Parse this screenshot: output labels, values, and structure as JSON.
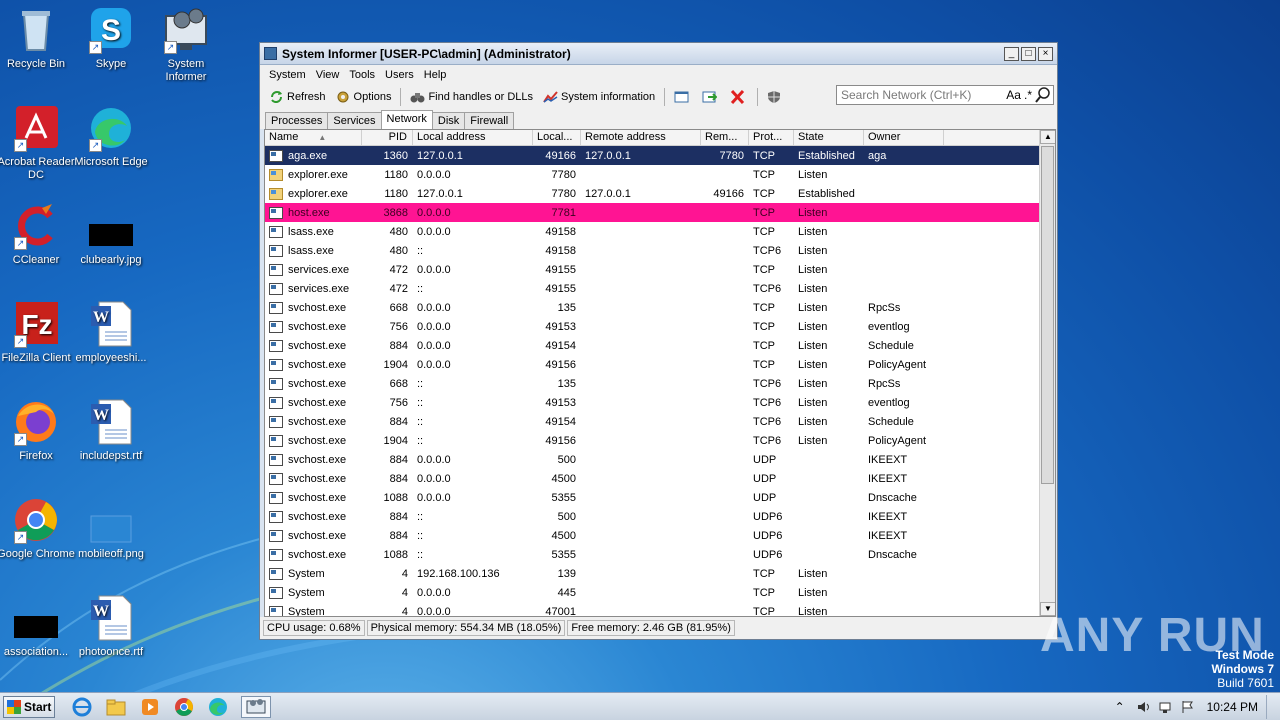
{
  "desktop": {
    "icons": [
      {
        "label": "Recycle Bin"
      },
      {
        "label": "Skype"
      },
      {
        "label": "System Informer"
      },
      {
        "label": "Acrobat Reader DC"
      },
      {
        "label": "Microsoft Edge"
      },
      {
        "label": "CCleaner"
      },
      {
        "label": "clubearly.jpg"
      },
      {
        "label": "FileZilla Client"
      },
      {
        "label": "employeeshi..."
      },
      {
        "label": "Firefox"
      },
      {
        "label": "includepst.rtf"
      },
      {
        "label": "Google Chrome"
      },
      {
        "label": "mobileoff.png"
      },
      {
        "label": "association..."
      },
      {
        "label": "photoonce.rtf"
      }
    ]
  },
  "window": {
    "title": "System Informer [USER-PC\\admin] (Administrator)",
    "controls": {
      "minimize": "_",
      "maximize": "□",
      "close": "×"
    },
    "menu": [
      "System",
      "View",
      "Tools",
      "Users",
      "Help"
    ],
    "toolbar": {
      "refresh": "Refresh",
      "options": "Options",
      "find_handles": "Find handles or DLLs",
      "system_information": "System information"
    },
    "search": {
      "placeholder": "Search Network (Ctrl+K)",
      "case_toggle": "Aa",
      "regex_toggle": ".*"
    },
    "tabs": [
      "Processes",
      "Services",
      "Network",
      "Disk",
      "Firewall"
    ],
    "active_tab": "Network",
    "columns": [
      "Name",
      "PID",
      "Local address",
      "Local...",
      "Remote address",
      "Rem...",
      "Prot...",
      "State",
      "Owner"
    ],
    "rows": [
      {
        "name": "aga.exe",
        "pid": "1360",
        "laddr": "127.0.0.1",
        "lport": "49166",
        "raddr": "127.0.0.1",
        "rport": "7780",
        "proto": "TCP",
        "state": "Established",
        "owner": "aga",
        "icon": "app"
      },
      {
        "name": "explorer.exe",
        "pid": "1180",
        "laddr": "0.0.0.0",
        "lport": "7780",
        "raddr": "",
        "rport": "",
        "proto": "TCP",
        "state": "Listen",
        "owner": "",
        "icon": "folder"
      },
      {
        "name": "explorer.exe",
        "pid": "1180",
        "laddr": "127.0.0.1",
        "lport": "7780",
        "raddr": "127.0.0.1",
        "rport": "49166",
        "proto": "TCP",
        "state": "Established",
        "owner": "",
        "icon": "folder"
      },
      {
        "name": "host.exe",
        "pid": "3868",
        "laddr": "0.0.0.0",
        "lport": "7781",
        "raddr": "",
        "rport": "",
        "proto": "TCP",
        "state": "Listen",
        "owner": "",
        "icon": "app"
      },
      {
        "name": "lsass.exe",
        "pid": "480",
        "laddr": "0.0.0.0",
        "lport": "49158",
        "raddr": "",
        "rport": "",
        "proto": "TCP",
        "state": "Listen",
        "owner": "",
        "icon": "app"
      },
      {
        "name": "lsass.exe",
        "pid": "480",
        "laddr": "::",
        "lport": "49158",
        "raddr": "",
        "rport": "",
        "proto": "TCP6",
        "state": "Listen",
        "owner": "",
        "icon": "app"
      },
      {
        "name": "services.exe",
        "pid": "472",
        "laddr": "0.0.0.0",
        "lport": "49155",
        "raddr": "",
        "rport": "",
        "proto": "TCP",
        "state": "Listen",
        "owner": "",
        "icon": "app"
      },
      {
        "name": "services.exe",
        "pid": "472",
        "laddr": "::",
        "lport": "49155",
        "raddr": "",
        "rport": "",
        "proto": "TCP6",
        "state": "Listen",
        "owner": "",
        "icon": "app"
      },
      {
        "name": "svchost.exe",
        "pid": "668",
        "laddr": "0.0.0.0",
        "lport": "135",
        "raddr": "",
        "rport": "",
        "proto": "TCP",
        "state": "Listen",
        "owner": "RpcSs",
        "icon": "app"
      },
      {
        "name": "svchost.exe",
        "pid": "756",
        "laddr": "0.0.0.0",
        "lport": "49153",
        "raddr": "",
        "rport": "",
        "proto": "TCP",
        "state": "Listen",
        "owner": "eventlog",
        "icon": "app"
      },
      {
        "name": "svchost.exe",
        "pid": "884",
        "laddr": "0.0.0.0",
        "lport": "49154",
        "raddr": "",
        "rport": "",
        "proto": "TCP",
        "state": "Listen",
        "owner": "Schedule",
        "icon": "app"
      },
      {
        "name": "svchost.exe",
        "pid": "1904",
        "laddr": "0.0.0.0",
        "lport": "49156",
        "raddr": "",
        "rport": "",
        "proto": "TCP",
        "state": "Listen",
        "owner": "PolicyAgent",
        "icon": "app"
      },
      {
        "name": "svchost.exe",
        "pid": "668",
        "laddr": "::",
        "lport": "135",
        "raddr": "",
        "rport": "",
        "proto": "TCP6",
        "state": "Listen",
        "owner": "RpcSs",
        "icon": "app"
      },
      {
        "name": "svchost.exe",
        "pid": "756",
        "laddr": "::",
        "lport": "49153",
        "raddr": "",
        "rport": "",
        "proto": "TCP6",
        "state": "Listen",
        "owner": "eventlog",
        "icon": "app"
      },
      {
        "name": "svchost.exe",
        "pid": "884",
        "laddr": "::",
        "lport": "49154",
        "raddr": "",
        "rport": "",
        "proto": "TCP6",
        "state": "Listen",
        "owner": "Schedule",
        "icon": "app"
      },
      {
        "name": "svchost.exe",
        "pid": "1904",
        "laddr": "::",
        "lport": "49156",
        "raddr": "",
        "rport": "",
        "proto": "TCP6",
        "state": "Listen",
        "owner": "PolicyAgent",
        "icon": "app"
      },
      {
        "name": "svchost.exe",
        "pid": "884",
        "laddr": "0.0.0.0",
        "lport": "500",
        "raddr": "",
        "rport": "",
        "proto": "UDP",
        "state": "",
        "owner": "IKEEXT",
        "icon": "app"
      },
      {
        "name": "svchost.exe",
        "pid": "884",
        "laddr": "0.0.0.0",
        "lport": "4500",
        "raddr": "",
        "rport": "",
        "proto": "UDP",
        "state": "",
        "owner": "IKEEXT",
        "icon": "app"
      },
      {
        "name": "svchost.exe",
        "pid": "1088",
        "laddr": "0.0.0.0",
        "lport": "5355",
        "raddr": "",
        "rport": "",
        "proto": "UDP",
        "state": "",
        "owner": "Dnscache",
        "icon": "app"
      },
      {
        "name": "svchost.exe",
        "pid": "884",
        "laddr": "::",
        "lport": "500",
        "raddr": "",
        "rport": "",
        "proto": "UDP6",
        "state": "",
        "owner": "IKEEXT",
        "icon": "app"
      },
      {
        "name": "svchost.exe",
        "pid": "884",
        "laddr": "::",
        "lport": "4500",
        "raddr": "",
        "rport": "",
        "proto": "UDP6",
        "state": "",
        "owner": "IKEEXT",
        "icon": "app"
      },
      {
        "name": "svchost.exe",
        "pid": "1088",
        "laddr": "::",
        "lport": "5355",
        "raddr": "",
        "rport": "",
        "proto": "UDP6",
        "state": "",
        "owner": "Dnscache",
        "icon": "app"
      },
      {
        "name": "System",
        "pid": "4",
        "laddr": "192.168.100.136",
        "lport": "139",
        "raddr": "",
        "rport": "",
        "proto": "TCP",
        "state": "Listen",
        "owner": "",
        "icon": "app"
      },
      {
        "name": "System",
        "pid": "4",
        "laddr": "0.0.0.0",
        "lport": "445",
        "raddr": "",
        "rport": "",
        "proto": "TCP",
        "state": "Listen",
        "owner": "",
        "icon": "app"
      },
      {
        "name": "System",
        "pid": "4",
        "laddr": "0.0.0.0",
        "lport": "47001",
        "raddr": "",
        "rport": "",
        "proto": "TCP",
        "state": "Listen",
        "owner": "",
        "icon": "app"
      }
    ],
    "row_highlights": {
      "selected": "#1c2f62",
      "pink": "#ff1493"
    },
    "status": {
      "cpu": "CPU usage: 0.68%",
      "physical": "Physical memory: 554.34 MB (18.05%)",
      "free": "Free memory: 2.46 GB (81.95%)"
    }
  },
  "watermark": {
    "brand": "ANY RUN",
    "test_mode": "Test Mode",
    "os": "Windows 7",
    "build": "Build 7601"
  },
  "taskbar": {
    "start": "Start",
    "clock": "10:24 PM"
  }
}
